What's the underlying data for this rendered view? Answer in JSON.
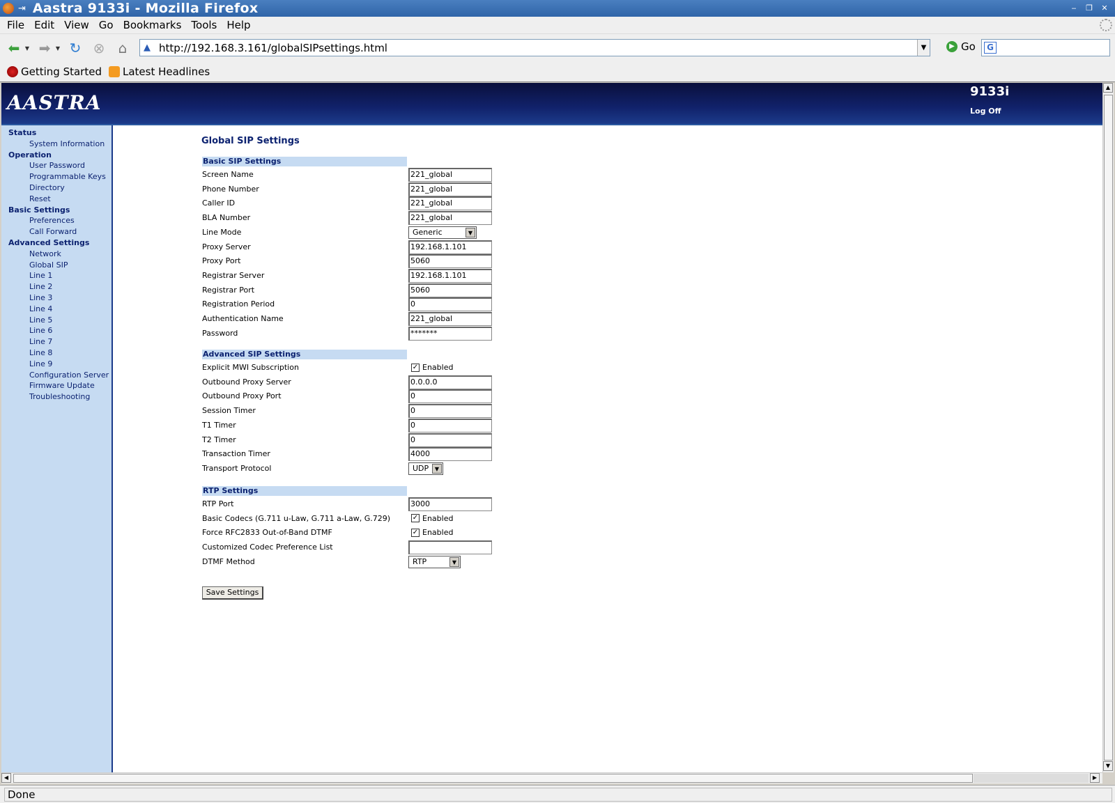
{
  "window": {
    "title": "Aastra 9133i - Mozilla Firefox",
    "pin_glyph": "⇥"
  },
  "menu": [
    "File",
    "Edit",
    "View",
    "Go",
    "Bookmarks",
    "Tools",
    "Help"
  ],
  "nav": {
    "url": "http://192.168.3.161/globalSIPsettings.html",
    "go_label": "Go"
  },
  "bookmarks": [
    "Getting Started",
    "Latest Headlines"
  ],
  "banner": {
    "logo": "AASTRA",
    "model": "9133i",
    "logoff": "Log Off"
  },
  "sidebar": [
    {
      "type": "section",
      "label": "Status"
    },
    {
      "type": "link",
      "label": "System Information"
    },
    {
      "type": "section",
      "label": "Operation"
    },
    {
      "type": "link",
      "label": "User Password"
    },
    {
      "type": "link",
      "label": "Programmable Keys"
    },
    {
      "type": "link",
      "label": "Directory"
    },
    {
      "type": "link",
      "label": "Reset"
    },
    {
      "type": "section",
      "label": "Basic Settings"
    },
    {
      "type": "link",
      "label": "Preferences"
    },
    {
      "type": "link",
      "label": "Call Forward"
    },
    {
      "type": "section",
      "label": "Advanced Settings"
    },
    {
      "type": "link",
      "label": "Network"
    },
    {
      "type": "link",
      "label": "Global SIP"
    },
    {
      "type": "link",
      "label": "Line 1"
    },
    {
      "type": "link",
      "label": "Line 2"
    },
    {
      "type": "link",
      "label": "Line 3"
    },
    {
      "type": "link",
      "label": "Line 4"
    },
    {
      "type": "link",
      "label": "Line 5"
    },
    {
      "type": "link",
      "label": "Line 6"
    },
    {
      "type": "link",
      "label": "Line 7"
    },
    {
      "type": "link",
      "label": "Line 8"
    },
    {
      "type": "link",
      "label": "Line 9"
    },
    {
      "type": "link",
      "label": "Configuration Server"
    },
    {
      "type": "link",
      "label": "Firmware Update"
    },
    {
      "type": "link",
      "label": "Troubleshooting"
    }
  ],
  "page": {
    "title": "Global SIP Settings",
    "save_label": "Save Settings",
    "status": "Done"
  },
  "sections": [
    {
      "header": "Basic SIP Settings",
      "fields": [
        {
          "label": "Screen Name",
          "kind": "text",
          "value": "221_global"
        },
        {
          "label": "Phone Number",
          "kind": "text",
          "value": "221_global"
        },
        {
          "label": "Caller ID",
          "kind": "text",
          "value": "221_global"
        },
        {
          "label": "BLA Number",
          "kind": "text",
          "value": "221_global"
        },
        {
          "label": "Line Mode",
          "kind": "select",
          "value": "Generic"
        },
        {
          "label": "Proxy Server",
          "kind": "text",
          "value": "192.168.1.101"
        },
        {
          "label": "Proxy Port",
          "kind": "text",
          "value": "5060"
        },
        {
          "label": "Registrar Server",
          "kind": "text",
          "value": "192.168.1.101"
        },
        {
          "label": "Registrar Port",
          "kind": "text",
          "value": "5060"
        },
        {
          "label": "Registration Period",
          "kind": "text",
          "value": "0"
        },
        {
          "label": "Authentication Name",
          "kind": "text",
          "value": "221_global"
        },
        {
          "label": "Password",
          "kind": "text",
          "value": "*******"
        }
      ]
    },
    {
      "header": "Advanced SIP Settings",
      "fields": [
        {
          "label": "Explicit MWI Subscription",
          "kind": "check",
          "value": "Enabled"
        },
        {
          "label": "Outbound Proxy Server",
          "kind": "text",
          "value": "0.0.0.0"
        },
        {
          "label": "Outbound Proxy Port",
          "kind": "text",
          "value": "0"
        },
        {
          "label": "Session Timer",
          "kind": "text",
          "value": "0"
        },
        {
          "label": "T1 Timer",
          "kind": "text",
          "value": "0"
        },
        {
          "label": "T2 Timer",
          "kind": "text",
          "value": "0"
        },
        {
          "label": "Transaction Timer",
          "kind": "text",
          "value": "4000"
        },
        {
          "label": "Transport Protocol",
          "kind": "select",
          "value": "UDP"
        }
      ]
    },
    {
      "header": "RTP Settings",
      "fields": [
        {
          "label": "RTP Port",
          "kind": "text",
          "value": "3000"
        },
        {
          "label": "Basic Codecs (G.711 u-Law, G.711 a-Law, G.729)",
          "kind": "check",
          "value": "Enabled"
        },
        {
          "label": "Force RFC2833 Out-of-Band DTMF",
          "kind": "check",
          "value": "Enabled"
        },
        {
          "label": "Customized Codec Preference List",
          "kind": "text",
          "value": ""
        },
        {
          "label": "DTMF Method",
          "kind": "select",
          "value": "RTP"
        }
      ]
    }
  ]
}
